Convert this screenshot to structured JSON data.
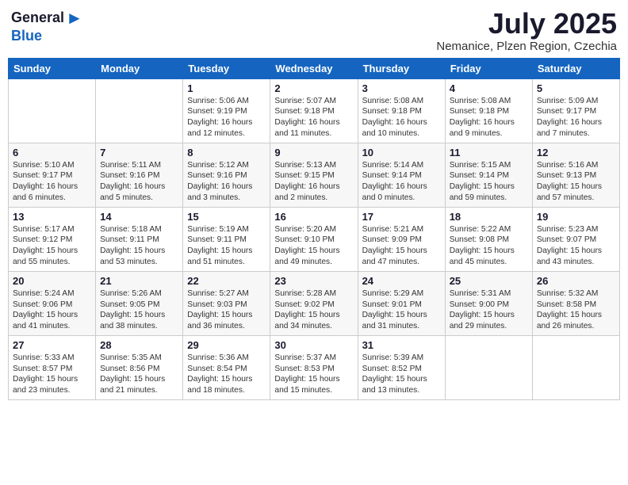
{
  "header": {
    "logo_general": "General",
    "logo_blue": "Blue",
    "month": "July 2025",
    "location": "Nemanice, Plzen Region, Czechia"
  },
  "weekdays": [
    "Sunday",
    "Monday",
    "Tuesday",
    "Wednesday",
    "Thursday",
    "Friday",
    "Saturday"
  ],
  "weeks": [
    [
      {
        "day": "",
        "info": ""
      },
      {
        "day": "",
        "info": ""
      },
      {
        "day": "1",
        "info": "Sunrise: 5:06 AM\nSunset: 9:19 PM\nDaylight: 16 hours\nand 12 minutes."
      },
      {
        "day": "2",
        "info": "Sunrise: 5:07 AM\nSunset: 9:18 PM\nDaylight: 16 hours\nand 11 minutes."
      },
      {
        "day": "3",
        "info": "Sunrise: 5:08 AM\nSunset: 9:18 PM\nDaylight: 16 hours\nand 10 minutes."
      },
      {
        "day": "4",
        "info": "Sunrise: 5:08 AM\nSunset: 9:18 PM\nDaylight: 16 hours\nand 9 minutes."
      },
      {
        "day": "5",
        "info": "Sunrise: 5:09 AM\nSunset: 9:17 PM\nDaylight: 16 hours\nand 7 minutes."
      }
    ],
    [
      {
        "day": "6",
        "info": "Sunrise: 5:10 AM\nSunset: 9:17 PM\nDaylight: 16 hours\nand 6 minutes."
      },
      {
        "day": "7",
        "info": "Sunrise: 5:11 AM\nSunset: 9:16 PM\nDaylight: 16 hours\nand 5 minutes."
      },
      {
        "day": "8",
        "info": "Sunrise: 5:12 AM\nSunset: 9:16 PM\nDaylight: 16 hours\nand 3 minutes."
      },
      {
        "day": "9",
        "info": "Sunrise: 5:13 AM\nSunset: 9:15 PM\nDaylight: 16 hours\nand 2 minutes."
      },
      {
        "day": "10",
        "info": "Sunrise: 5:14 AM\nSunset: 9:14 PM\nDaylight: 16 hours\nand 0 minutes."
      },
      {
        "day": "11",
        "info": "Sunrise: 5:15 AM\nSunset: 9:14 PM\nDaylight: 15 hours\nand 59 minutes."
      },
      {
        "day": "12",
        "info": "Sunrise: 5:16 AM\nSunset: 9:13 PM\nDaylight: 15 hours\nand 57 minutes."
      }
    ],
    [
      {
        "day": "13",
        "info": "Sunrise: 5:17 AM\nSunset: 9:12 PM\nDaylight: 15 hours\nand 55 minutes."
      },
      {
        "day": "14",
        "info": "Sunrise: 5:18 AM\nSunset: 9:11 PM\nDaylight: 15 hours\nand 53 minutes."
      },
      {
        "day": "15",
        "info": "Sunrise: 5:19 AM\nSunset: 9:11 PM\nDaylight: 15 hours\nand 51 minutes."
      },
      {
        "day": "16",
        "info": "Sunrise: 5:20 AM\nSunset: 9:10 PM\nDaylight: 15 hours\nand 49 minutes."
      },
      {
        "day": "17",
        "info": "Sunrise: 5:21 AM\nSunset: 9:09 PM\nDaylight: 15 hours\nand 47 minutes."
      },
      {
        "day": "18",
        "info": "Sunrise: 5:22 AM\nSunset: 9:08 PM\nDaylight: 15 hours\nand 45 minutes."
      },
      {
        "day": "19",
        "info": "Sunrise: 5:23 AM\nSunset: 9:07 PM\nDaylight: 15 hours\nand 43 minutes."
      }
    ],
    [
      {
        "day": "20",
        "info": "Sunrise: 5:24 AM\nSunset: 9:06 PM\nDaylight: 15 hours\nand 41 minutes."
      },
      {
        "day": "21",
        "info": "Sunrise: 5:26 AM\nSunset: 9:05 PM\nDaylight: 15 hours\nand 38 minutes."
      },
      {
        "day": "22",
        "info": "Sunrise: 5:27 AM\nSunset: 9:03 PM\nDaylight: 15 hours\nand 36 minutes."
      },
      {
        "day": "23",
        "info": "Sunrise: 5:28 AM\nSunset: 9:02 PM\nDaylight: 15 hours\nand 34 minutes."
      },
      {
        "day": "24",
        "info": "Sunrise: 5:29 AM\nSunset: 9:01 PM\nDaylight: 15 hours\nand 31 minutes."
      },
      {
        "day": "25",
        "info": "Sunrise: 5:31 AM\nSunset: 9:00 PM\nDaylight: 15 hours\nand 29 minutes."
      },
      {
        "day": "26",
        "info": "Sunrise: 5:32 AM\nSunset: 8:58 PM\nDaylight: 15 hours\nand 26 minutes."
      }
    ],
    [
      {
        "day": "27",
        "info": "Sunrise: 5:33 AM\nSunset: 8:57 PM\nDaylight: 15 hours\nand 23 minutes."
      },
      {
        "day": "28",
        "info": "Sunrise: 5:35 AM\nSunset: 8:56 PM\nDaylight: 15 hours\nand 21 minutes."
      },
      {
        "day": "29",
        "info": "Sunrise: 5:36 AM\nSunset: 8:54 PM\nDaylight: 15 hours\nand 18 minutes."
      },
      {
        "day": "30",
        "info": "Sunrise: 5:37 AM\nSunset: 8:53 PM\nDaylight: 15 hours\nand 15 minutes."
      },
      {
        "day": "31",
        "info": "Sunrise: 5:39 AM\nSunset: 8:52 PM\nDaylight: 15 hours\nand 13 minutes."
      },
      {
        "day": "",
        "info": ""
      },
      {
        "day": "",
        "info": ""
      }
    ]
  ]
}
